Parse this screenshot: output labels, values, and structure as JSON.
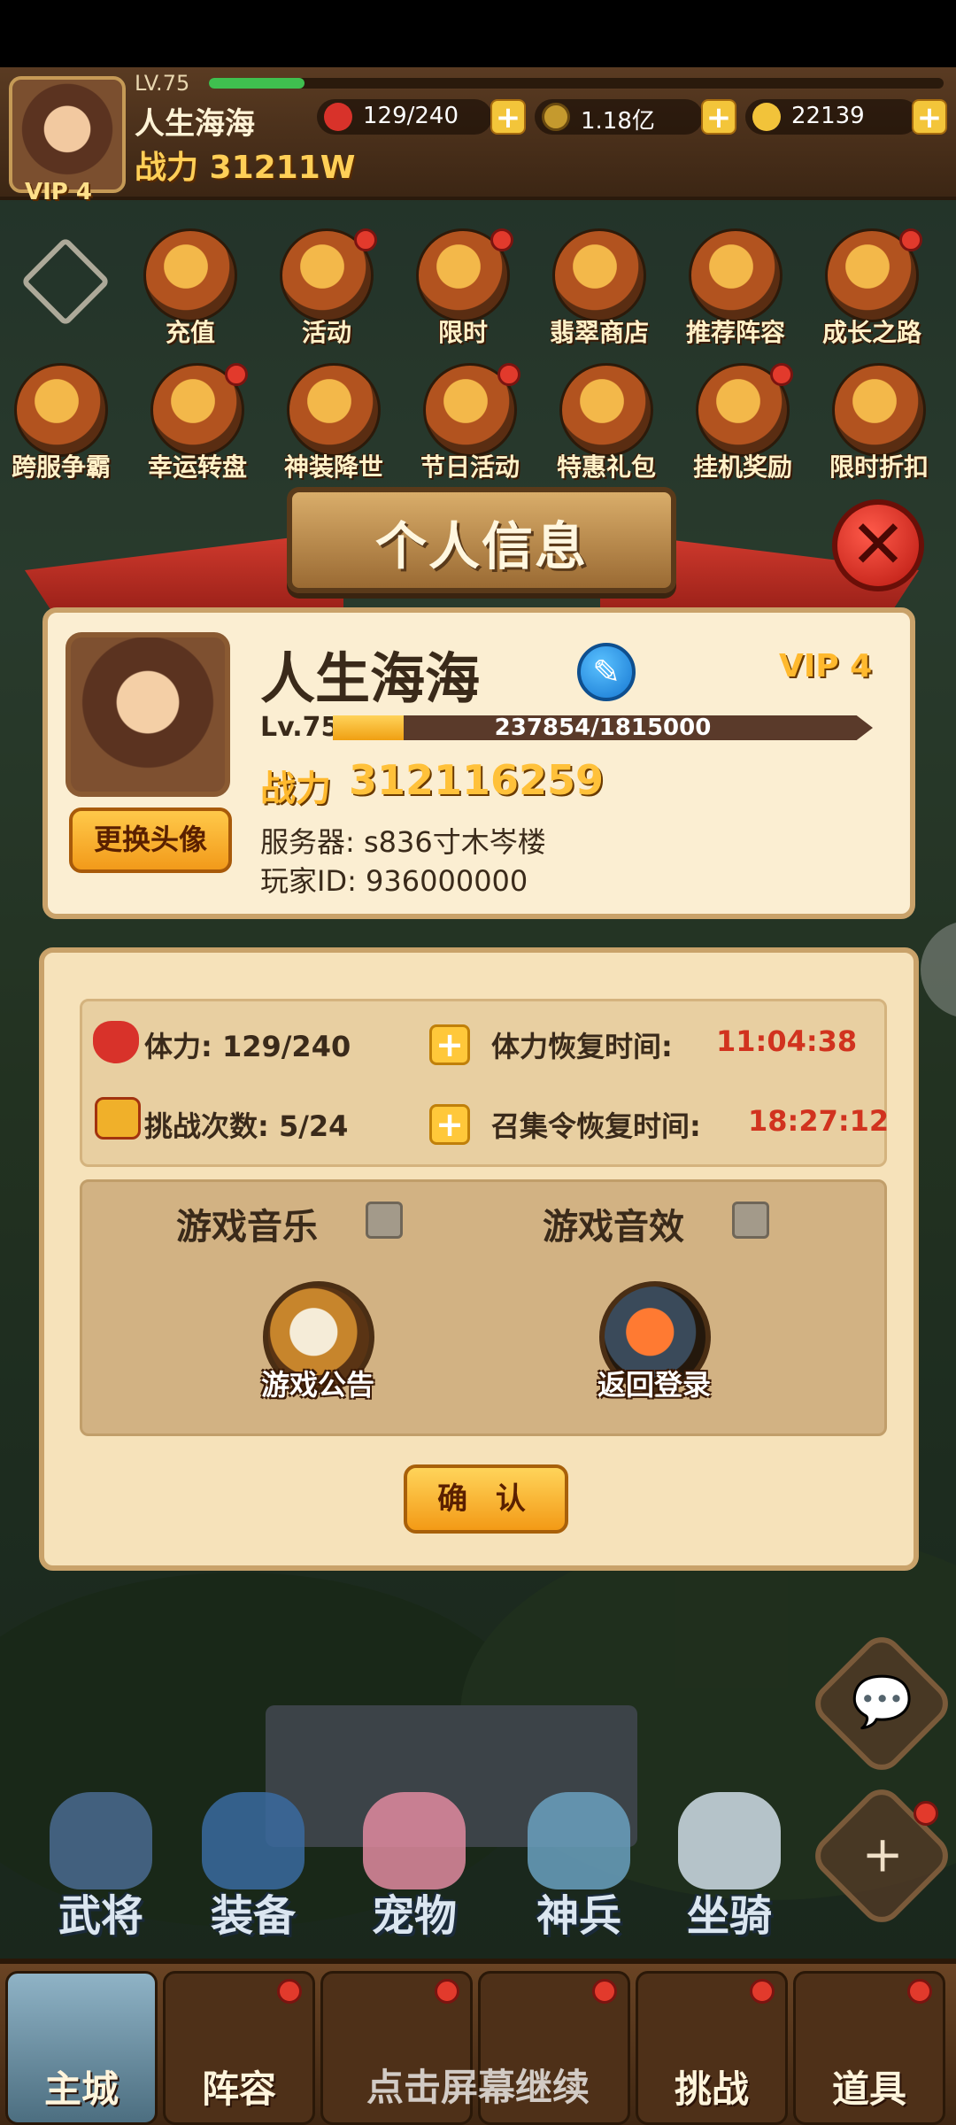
{
  "hud": {
    "level": "LV.75",
    "level_progress": 0.13,
    "name": "人生海海",
    "power": "战力 31211W",
    "vip": "VIP 4",
    "stamina": "129/240",
    "gold": "1.18亿",
    "gems": "22139",
    "plus": "+"
  },
  "activities": [
    {
      "label": "充值",
      "dot": false
    },
    {
      "label": "活动",
      "dot": true
    },
    {
      "label": "限时",
      "dot": true
    },
    {
      "label": "翡翠商店",
      "dot": false
    },
    {
      "label": "推荐阵容",
      "dot": false
    },
    {
      "label": "成长之路",
      "dot": true
    },
    {
      "label": "跨服争霸",
      "dot": false
    },
    {
      "label": "幸运转盘",
      "dot": true
    },
    {
      "label": "神装降世",
      "dot": false
    },
    {
      "label": "节日活动",
      "dot": true
    },
    {
      "label": "特惠礼包",
      "dot": false
    },
    {
      "label": "挂机奖励",
      "dot": true
    },
    {
      "label": "限时折扣",
      "dot": false
    }
  ],
  "modal": {
    "title": "个人信息",
    "close": "✕",
    "change_avatar": "更换头像",
    "name": "人生海海",
    "vip": "VIP 4",
    "level": "Lv.75",
    "exp_text": "237854/1815000",
    "exp_fraction": 0.131,
    "power_label": "战力",
    "power": "312116259",
    "server": "服务器:  s836寸木岑楼",
    "player_id": "玩家ID:  936000000",
    "stamina_label": "体力:  129/240",
    "stamina_recover_label": "体力恢复时间:",
    "stamina_recover_time": "11:04:38",
    "challenge_label": "挑战次数:  5/24",
    "summon_recover_label": "召集令恢复时间:",
    "summon_recover_time": "18:27:12",
    "music_label": "游戏音乐",
    "sound_label": "游戏音效",
    "music_on": false,
    "sound_on": false,
    "announcement": "游戏公告",
    "back_login": "返回登录",
    "confirm": "确 认",
    "plus": "+"
  },
  "hero_nav": [
    "武将",
    "装备",
    "宠物",
    "神兵",
    "坐骑"
  ],
  "side": {
    "chat": "💬",
    "plus": "+"
  },
  "tabs": [
    {
      "label": "主城",
      "dot": false
    },
    {
      "label": "阵容",
      "dot": true
    },
    {
      "label": "",
      "dot": true
    },
    {
      "label": "",
      "dot": true
    },
    {
      "label": "挑战",
      "dot": true
    },
    {
      "label": "道具",
      "dot": true
    }
  ],
  "hint": "点击屏幕继续"
}
